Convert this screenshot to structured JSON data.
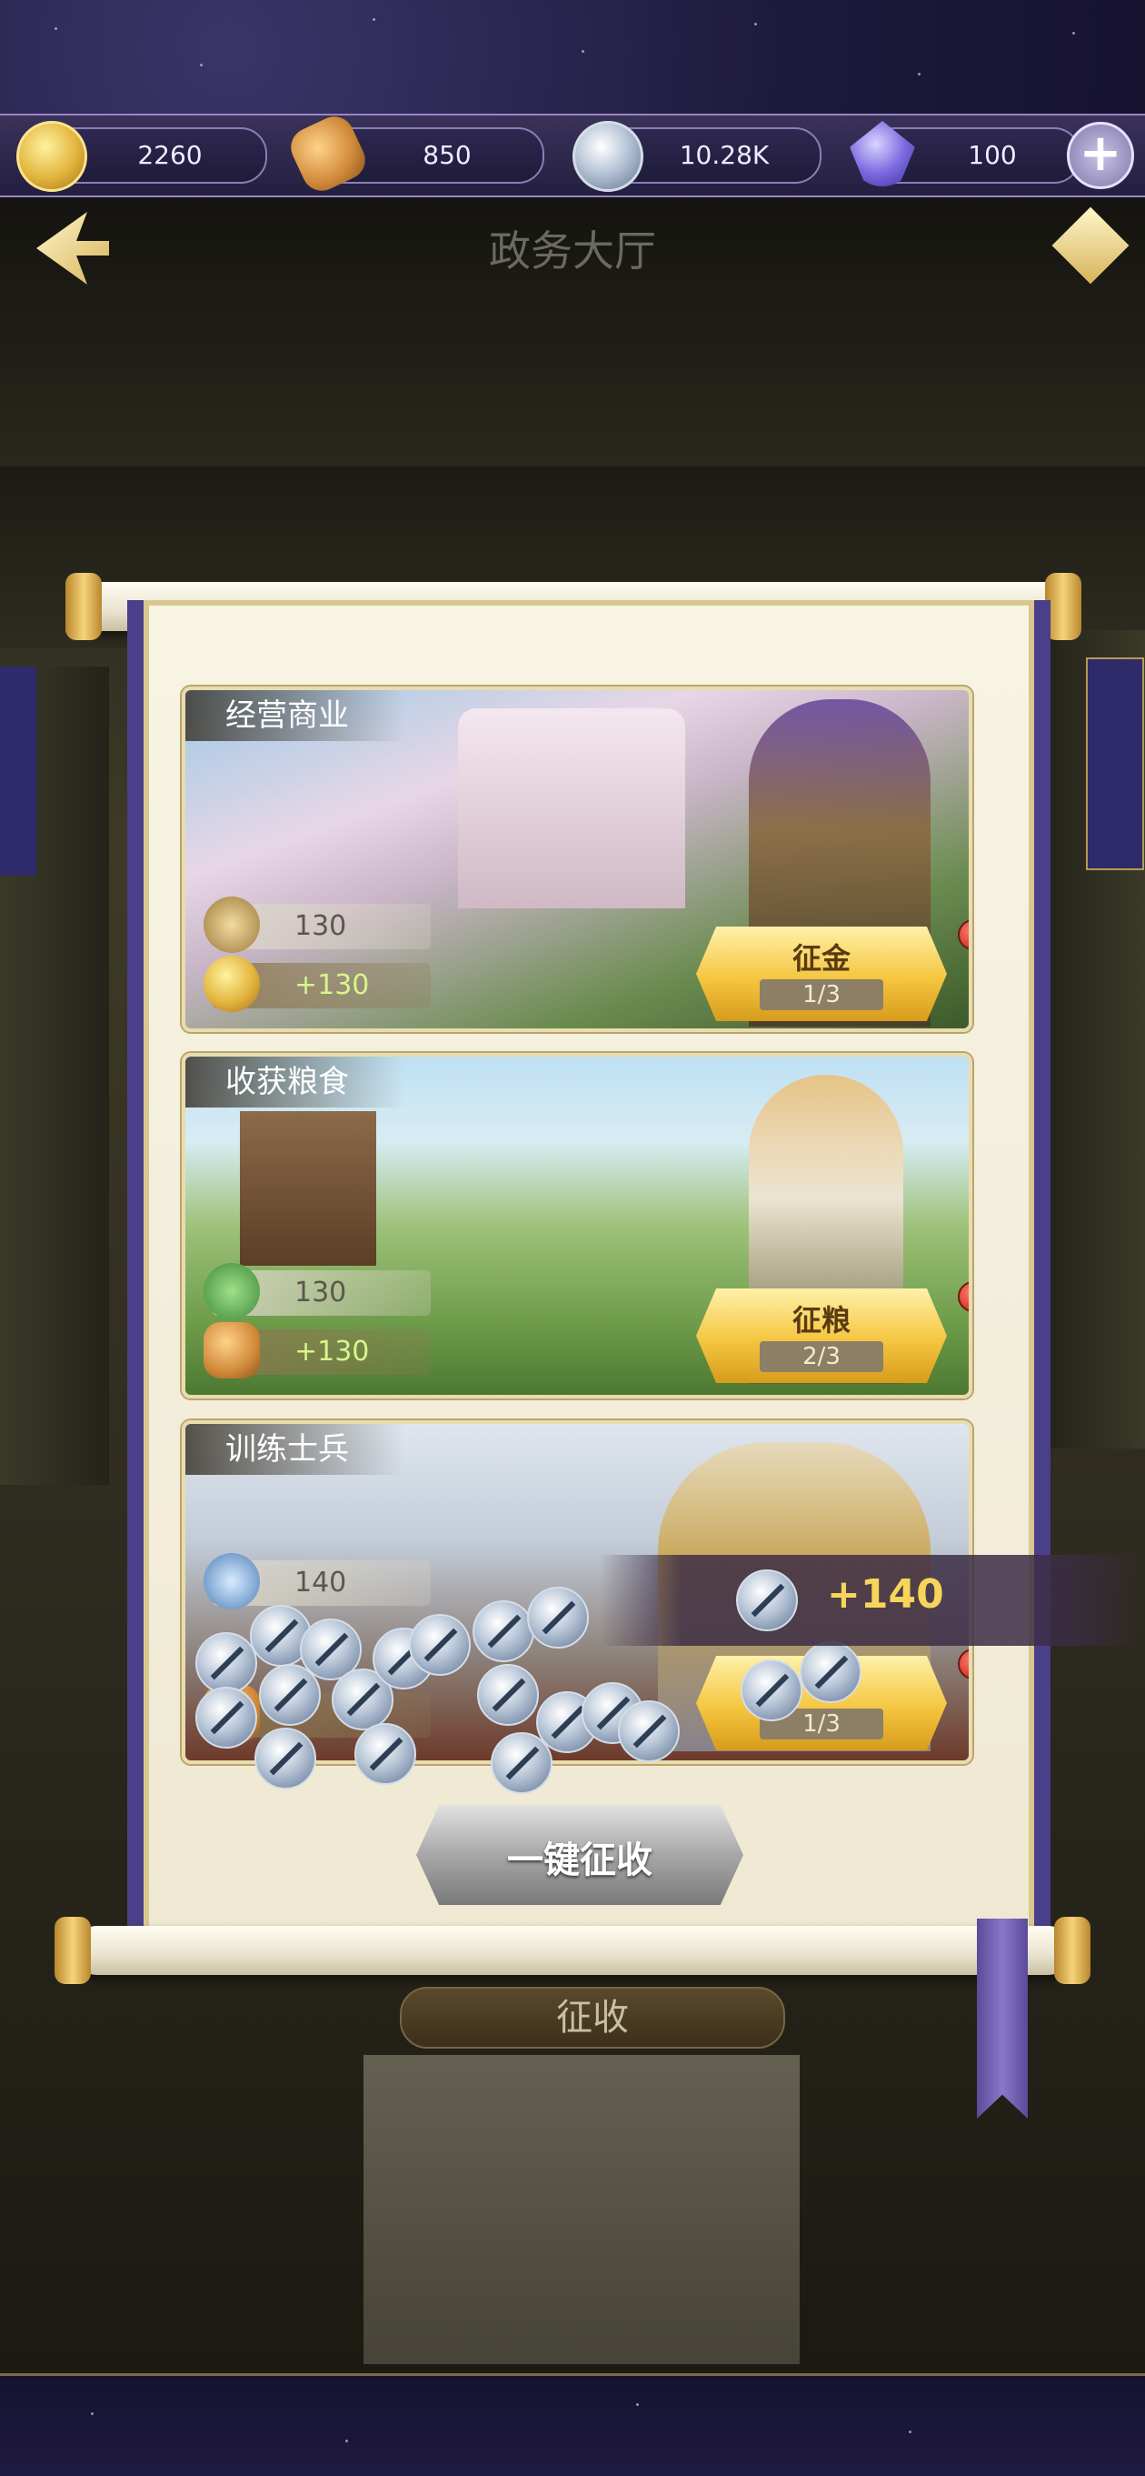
{
  "resources": [
    {
      "name": "gold",
      "value": "2260",
      "icon": "gold-coin-icon"
    },
    {
      "name": "bread",
      "value": "850",
      "icon": "bread-icon"
    },
    {
      "name": "soldiers",
      "value": "10.28K",
      "icon": "sword-icon"
    },
    {
      "name": "gem",
      "value": "100",
      "icon": "crystal-icon"
    }
  ],
  "add_label": "+",
  "hall_title": "政务大厅",
  "cards": [
    {
      "title": "经营商业",
      "stat": "130",
      "gain": "+130",
      "button": "征金",
      "count": "1/3",
      "stat_icon": "scale-icon",
      "gain_icon": "gold-coin-icon"
    },
    {
      "title": "收获粮食",
      "stat": "130",
      "gain": "+130",
      "button": "征粮",
      "count": "2/3",
      "stat_icon": "tools-icon",
      "gain_icon": "bread-icon"
    },
    {
      "title": "训练士兵",
      "stat": "140",
      "gain": "",
      "button": "",
      "count": "1/3",
      "stat_icon": "heart-icon",
      "gain_icon": "bread-icon"
    }
  ],
  "reward_popup": "+140",
  "one_key_collect": "一键征收",
  "bottom_collect": "征收",
  "colors": {
    "accent_gold": "#f5c640",
    "scroll_trim": "#4a3f8a",
    "reward_text": "#f7d55a"
  }
}
